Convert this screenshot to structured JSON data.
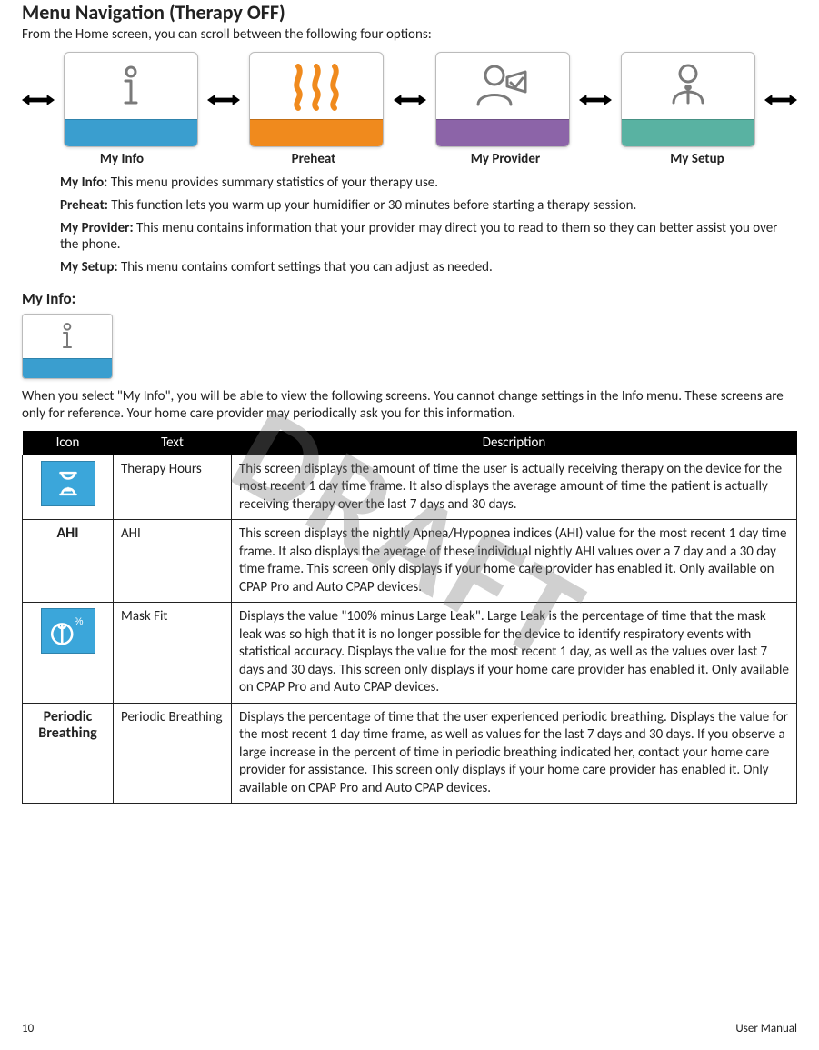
{
  "page": {
    "title": "Menu Navigation (Therapy OFF)",
    "intro": "From the Home screen, you can scroll between the following four options:",
    "footer_left": "10",
    "footer_right": "User Manual",
    "watermark": "DRAFT"
  },
  "nav": {
    "items": [
      {
        "label": "My Info"
      },
      {
        "label": "Preheat"
      },
      {
        "label": "My Provider"
      },
      {
        "label": "My Setup"
      }
    ]
  },
  "bullets": [
    {
      "term": "My Info:",
      "body": " This menu provides summary statistics of your therapy use."
    },
    {
      "term": "Preheat:",
      "body": " This function lets you warm up your humidifier  or 30 minutes before starting a therapy session."
    },
    {
      "term": "My Provider:",
      "body": " This menu contains information that your provider may direct you to read to them so they can better assist you over the phone."
    },
    {
      "term": "My Setup:",
      "body": " This menu contains comfort settings that you can adjust as needed."
    }
  ],
  "myinfo": {
    "heading": "My Info:",
    "note": "When you select \"My Info\", you will be able to view the following screens. You cannot change settings in the Info menu. These screens are only for reference. Your home care provider may periodically ask you for this information.",
    "headers": {
      "icon": "Icon",
      "text": "Text",
      "desc": "Description"
    },
    "rows": [
      {
        "icon_kind": "hourglass",
        "text": "Therapy Hours",
        "desc": "This screen displays the amount of time the user is actually receiving therapy on the device for the most recent 1 day time frame. It also displays the average amount of time the patient is actually receiving therapy over the last 7 days and 30 days."
      },
      {
        "icon_kind": "text",
        "icon_label": "AHI",
        "text": "AHI",
        "desc": "This screen displays the nightly Apnea/Hypopnea indices (AHI) value for the most recent 1 day time frame. It also displays the average of these individual nightly AHI values over a 7 day and a 30 day time frame. This screen only displays if your home care provider has enabled it. Only available on CPAP Pro and Auto CPAP devices."
      },
      {
        "icon_kind": "maskfit",
        "text": "Mask Fit",
        "desc": "Displays the value \"100% minus Large Leak\". Large Leak is the percentage of time that the mask leak was so high that it is no longer possible for the device to identify respiratory events with statistical accuracy. Displays the value for the most recent 1 day, as well as the values over last 7 days and 30 days. This screen only displays if your home care provider has enabled it. Only available on CPAP Pro and Auto CPAP devices."
      },
      {
        "icon_kind": "text",
        "icon_label": "Periodic Breathing",
        "text": "Periodic Breathing",
        "desc": "Displays the percentage of time that the user experienced periodic breathing. Displays the value for the most recent 1 day time frame, as well as values for the last 7 days and 30 days. If you observe a large increase in the percent of time in periodic breathing indicated her, contact your home care provider for assistance. This screen only displays if your home care provider has enabled it. Only available on CPAP Pro and Auto CPAP devices."
      }
    ]
  }
}
